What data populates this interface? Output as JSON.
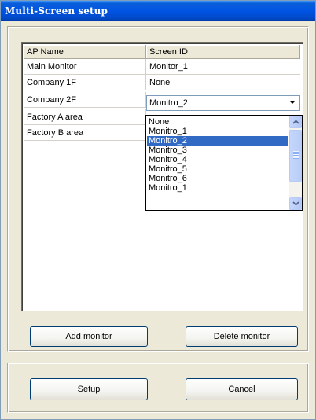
{
  "window": {
    "title": "Multi-Screen setup"
  },
  "table": {
    "columns": [
      "AP Name",
      "Screen ID"
    ],
    "rows": [
      {
        "ap_name": "Main Monitor",
        "screen_id": "Monitor_1"
      },
      {
        "ap_name": "Company 1F",
        "screen_id": "None"
      },
      {
        "ap_name": "Company 2F",
        "screen_id": "Monitro_2"
      },
      {
        "ap_name": "Factory A area",
        "screen_id": ""
      },
      {
        "ap_name": "Factory B area",
        "screen_id": ""
      }
    ]
  },
  "dropdown": {
    "selected": "Monitro_2",
    "options": [
      "None",
      "Monitro_1",
      "Monitro_2",
      "Monitro_3",
      "Monitro_4",
      "Monitro_5",
      "Monitro_6",
      "Monitro_1"
    ]
  },
  "buttons": {
    "add_monitor": "Add monitor",
    "delete_monitor": "Delete monitor",
    "setup": "Setup",
    "cancel": "Cancel"
  },
  "colors": {
    "title_bar": "#0054e3",
    "selection": "#316ac5",
    "dialog_bg": "#ece9d8"
  }
}
